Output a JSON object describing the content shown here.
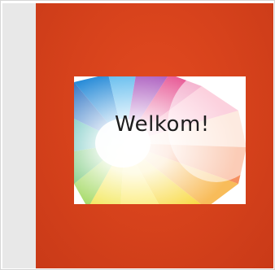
{
  "slide": {
    "title": "Welkom!",
    "background_color": "#d8431c",
    "card_color": "#ffffff"
  }
}
